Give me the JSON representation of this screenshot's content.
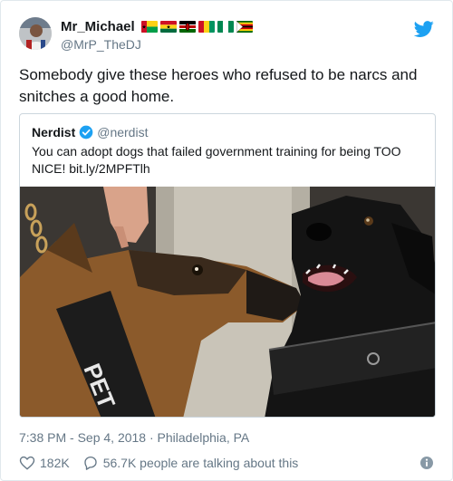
{
  "author": {
    "display_name": "Mr_Michael",
    "handle": "@MrP_TheDJ",
    "flags": [
      "guinea-bissau-flag",
      "ghana-flag",
      "kenya-flag",
      "guinea-flag",
      "nigeria-flag",
      "zimbabwe-flag"
    ]
  },
  "tweet": {
    "text": "Somebody give these heroes who refused to be narcs and snitches a good home."
  },
  "quote": {
    "name": "Nerdist",
    "handle": "@nerdist",
    "text": "You can adopt dogs that failed government training for being TOO NICE! bit.ly/2MPFTlh",
    "image_caption": "",
    "harness_text": "PET"
  },
  "meta": {
    "timestamp": "7:38 PM - Sep 4, 2018 · Philadelphia, PA",
    "likes": "182K",
    "conversation": "56.7K people are talking about this"
  },
  "colors": {
    "brand": "#1da1f2",
    "text": "#14171a",
    "muted": "#657786",
    "border": "#ccd6dd"
  }
}
